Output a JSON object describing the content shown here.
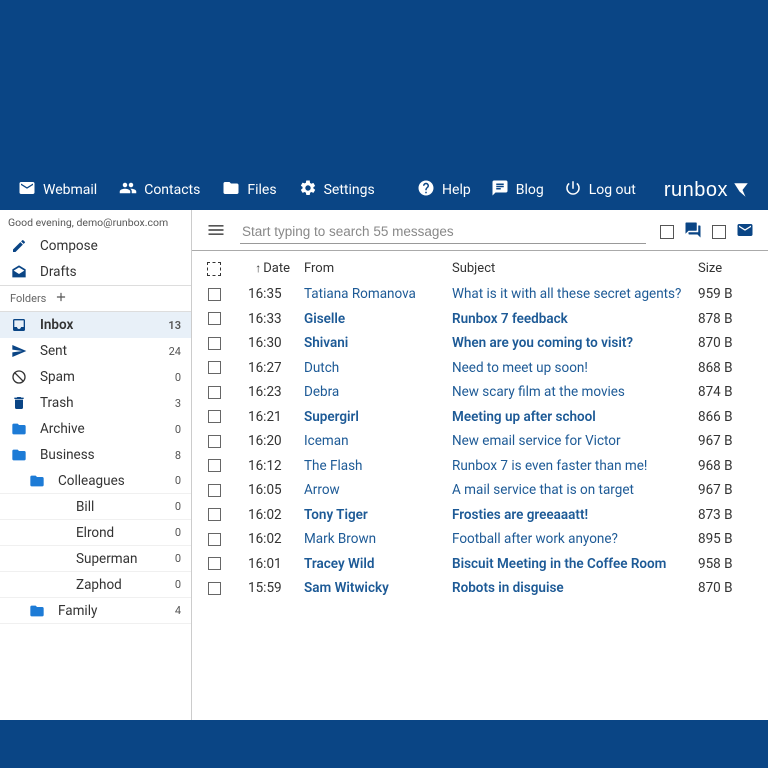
{
  "greeting": "Good evening, demo@runbox.com",
  "header": {
    "left": [
      {
        "icon": "mail",
        "label": "Webmail"
      },
      {
        "icon": "contacts",
        "label": "Contacts"
      },
      {
        "icon": "folder",
        "label": "Files"
      },
      {
        "icon": "gear",
        "label": "Settings"
      }
    ],
    "right": [
      {
        "icon": "help",
        "label": "Help"
      },
      {
        "icon": "blog",
        "label": "Blog"
      },
      {
        "icon": "power",
        "label": "Log out"
      }
    ],
    "brand": "runbox"
  },
  "sidebar": {
    "compose": "Compose",
    "drafts": "Drafts",
    "folders_label": "Folders",
    "system": [
      {
        "icon": "inbox",
        "label": "Inbox",
        "count": "13",
        "selected": true
      },
      {
        "icon": "sent",
        "label": "Sent",
        "count": "24"
      },
      {
        "icon": "spam",
        "label": "Spam",
        "count": "0"
      },
      {
        "icon": "trash",
        "label": "Trash",
        "count": "3"
      },
      {
        "icon": "folder",
        "label": "Archive",
        "count": "0"
      },
      {
        "icon": "folder",
        "label": "Business",
        "count": "8"
      }
    ],
    "subfolders": [
      {
        "indent": 1,
        "label": "Colleagues",
        "count": "0",
        "icon": "folder"
      },
      {
        "indent": 2,
        "label": "Bill",
        "count": "0"
      },
      {
        "indent": 2,
        "label": "Elrond",
        "count": "0"
      },
      {
        "indent": 2,
        "label": "Superman",
        "count": "0"
      },
      {
        "indent": 2,
        "label": "Zaphod",
        "count": "0"
      },
      {
        "indent": 1,
        "label": "Family",
        "count": "4",
        "icon": "folder"
      }
    ]
  },
  "search": {
    "placeholder": "Start typing to search 55 messages"
  },
  "columns": {
    "date": "Date",
    "from": "From",
    "subject": "Subject",
    "size": "Size"
  },
  "messages": [
    {
      "time": "16:35",
      "from": "Tatiana Romanova",
      "subject": "What is it with all these secret agents?",
      "size": "959 B",
      "unread": false
    },
    {
      "time": "16:33",
      "from": "Giselle",
      "subject": "Runbox 7 feedback",
      "size": "878 B",
      "unread": true
    },
    {
      "time": "16:30",
      "from": "Shivani",
      "subject": "When are you coming to visit?",
      "size": "870 B",
      "unread": true
    },
    {
      "time": "16:27",
      "from": "Dutch",
      "subject": "Need to meet up soon!",
      "size": "868 B",
      "unread": false
    },
    {
      "time": "16:23",
      "from": "Debra",
      "subject": "New scary film at the movies",
      "size": "874 B",
      "unread": false
    },
    {
      "time": "16:21",
      "from": "Supergirl",
      "subject": "Meeting up after school",
      "size": "866 B",
      "unread": true
    },
    {
      "time": "16:20",
      "from": "Iceman",
      "subject": "New email service for Victor",
      "size": "967 B",
      "unread": false
    },
    {
      "time": "16:12",
      "from": "The Flash",
      "subject": "Runbox 7 is even faster than me!",
      "size": "968 B",
      "unread": false
    },
    {
      "time": "16:05",
      "from": "Arrow",
      "subject": "A mail service that is on target",
      "size": "967 B",
      "unread": false
    },
    {
      "time": "16:02",
      "from": "Tony Tiger",
      "subject": "Frosties are greeaaatt!",
      "size": "873 B",
      "unread": true
    },
    {
      "time": "16:02",
      "from": "Mark Brown",
      "subject": "Football after work anyone?",
      "size": "895 B",
      "unread": false
    },
    {
      "time": "16:01",
      "from": "Tracey Wild",
      "subject": "Biscuit Meeting in the Coffee Room",
      "size": "958 B",
      "unread": true
    },
    {
      "time": "15:59",
      "from": "Sam Witwicky",
      "subject": "Robots in disguise",
      "size": "870 B",
      "unread": true
    }
  ]
}
